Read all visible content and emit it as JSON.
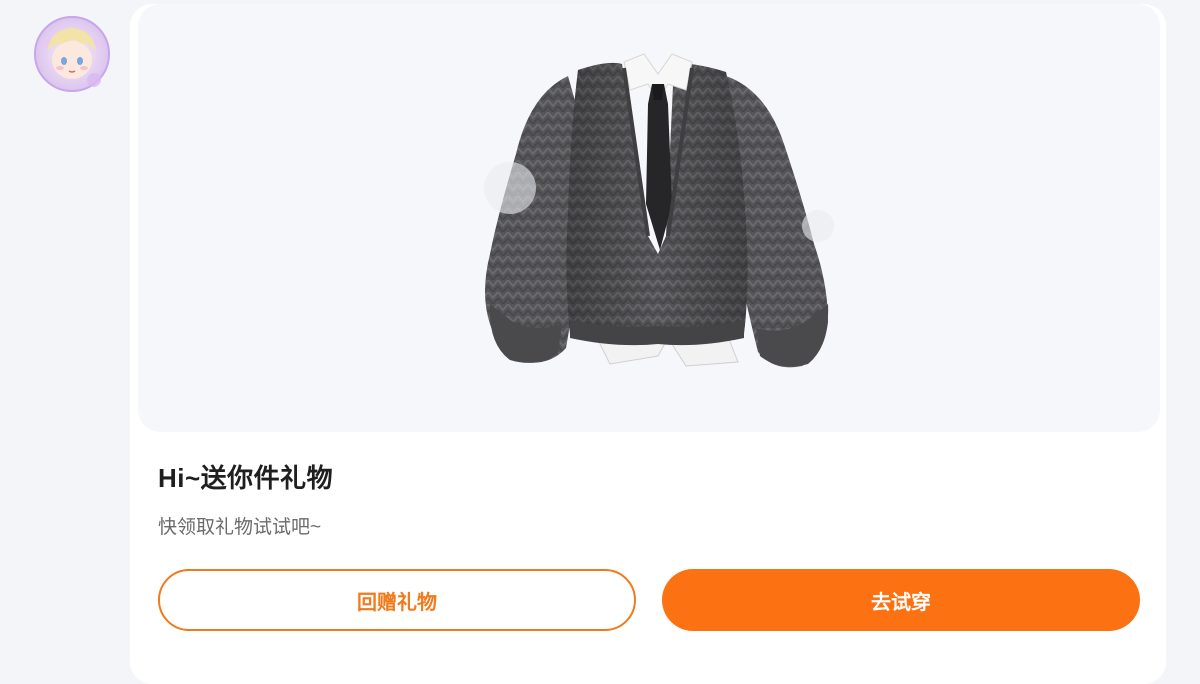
{
  "avatar": {
    "icon": "anime-avatar-icon"
  },
  "gift": {
    "image_icon": "cardigan-sweater-icon",
    "title": "Hi~送你件礼物",
    "subtitle": "快领取礼物试试吧~"
  },
  "actions": {
    "return_gift_label": "回赠礼物",
    "try_on_label": "去试穿"
  },
  "colors": {
    "accent": "#fc7112",
    "outline": "#f27a1a",
    "background": "#f4f5f8",
    "card": "#ffffff",
    "image_bg": "#f6f7fb"
  }
}
